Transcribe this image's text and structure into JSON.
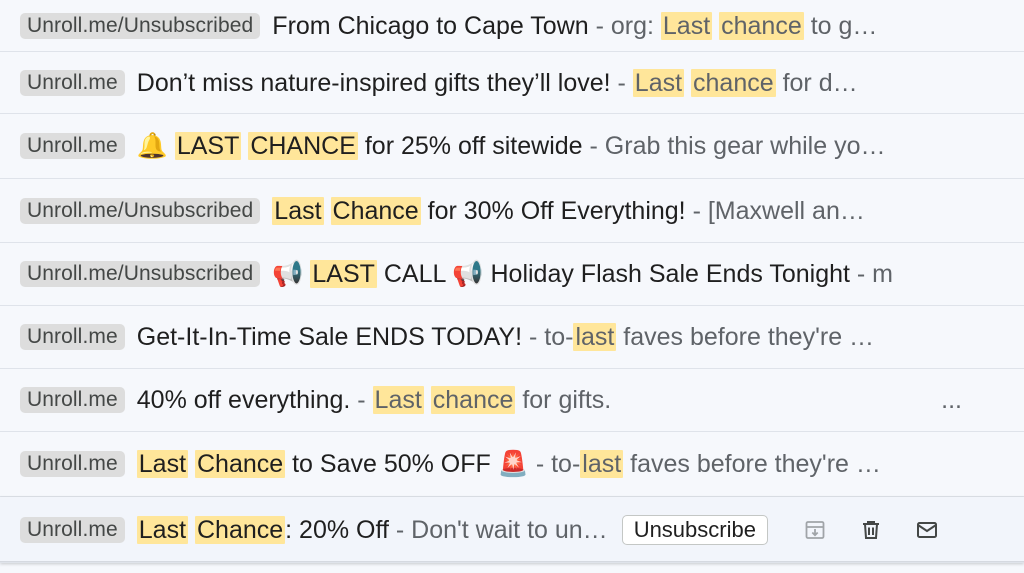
{
  "emails": [
    {
      "label": "Unroll.me/Unsubscribed",
      "subject": [
        [
          "From Chicago to Cape Town",
          false
        ]
      ],
      "separator": " - ",
      "snippet": [
        [
          "org: ",
          false
        ],
        [
          "Last",
          true
        ],
        [
          " ",
          false
        ],
        [
          "chance",
          true
        ],
        [
          " to g…",
          false
        ]
      ]
    },
    {
      "label": "Unroll.me",
      "subject": [
        [
          "Don’t miss nature-inspired gifts they’ll love!",
          false
        ]
      ],
      "separator": " - ",
      "snippet": [
        [
          "Last",
          true
        ],
        [
          " ",
          false
        ],
        [
          "chance",
          true
        ],
        [
          " for d…",
          false
        ]
      ]
    },
    {
      "label": "Unroll.me",
      "subject": [
        [
          "🔔 ",
          false
        ],
        [
          "LAST",
          true
        ],
        [
          " ",
          false
        ],
        [
          "CHANCE",
          true
        ],
        [
          " for 25% off sitewide",
          false
        ]
      ],
      "separator": " - ",
      "snippet": [
        [
          "Grab this gear while yo…",
          false
        ]
      ]
    },
    {
      "label": "Unroll.me/Unsubscribed",
      "subject": [
        [
          "Last",
          true
        ],
        [
          " ",
          false
        ],
        [
          "Chance",
          true
        ],
        [
          " for 30% Off Everything!",
          false
        ]
      ],
      "separator": " - ",
      "snippet": [
        [
          "[Maxwell an…",
          false
        ]
      ]
    },
    {
      "label": "Unroll.me/Unsubscribed",
      "subject": [
        [
          "📢 ",
          false
        ],
        [
          "LAST",
          true
        ],
        [
          " CALL 📢 Holiday Flash Sale Ends Tonight",
          false
        ]
      ],
      "separator": " - ",
      "snippet": [
        [
          "m",
          false
        ]
      ]
    },
    {
      "label": "Unroll.me",
      "subject": [
        [
          "Get-It-In-Time Sale ENDS TODAY!",
          false
        ]
      ],
      "separator": " - ",
      "snippet": [
        [
          "to-",
          false
        ],
        [
          "last",
          true
        ],
        [
          " faves before they're …",
          false
        ]
      ]
    },
    {
      "label": "Unroll.me",
      "subject": [
        [
          "40% off everything.",
          false
        ]
      ],
      "separator": " - ",
      "snippet": [
        [
          "Last",
          true
        ],
        [
          " ",
          false
        ],
        [
          "chance",
          true
        ],
        [
          " for gifts.",
          false
        ]
      ],
      "trailing": "..."
    },
    {
      "label": "Unroll.me",
      "subject": [
        [
          "Last",
          true
        ],
        [
          " ",
          false
        ],
        [
          "Chance",
          true
        ],
        [
          " to Save 50% OFF 🚨",
          false
        ]
      ],
      "separator": " - ",
      "snippet": [
        [
          "to-",
          false
        ],
        [
          "last",
          true
        ],
        [
          " faves before they're …",
          false
        ]
      ]
    },
    {
      "label": "Unroll.me",
      "subject": [
        [
          "Last",
          true
        ],
        [
          " ",
          false
        ],
        [
          "Chance",
          true
        ],
        [
          ": 20% Off",
          false
        ]
      ],
      "separator": " - ",
      "snippet": [
        [
          "Don't wait to un…",
          false
        ]
      ],
      "hovered": true,
      "unsubscribe_label": "Unsubscribe",
      "actions": [
        "archive-icon",
        "delete-icon",
        "mark-unread-icon"
      ]
    }
  ],
  "colors": {
    "background": "#f6f8fc",
    "label_bg": "#dddddd",
    "highlight": "#ffe69a",
    "subject_text": "#1f1f1f",
    "snippet_text": "#5f6368"
  }
}
